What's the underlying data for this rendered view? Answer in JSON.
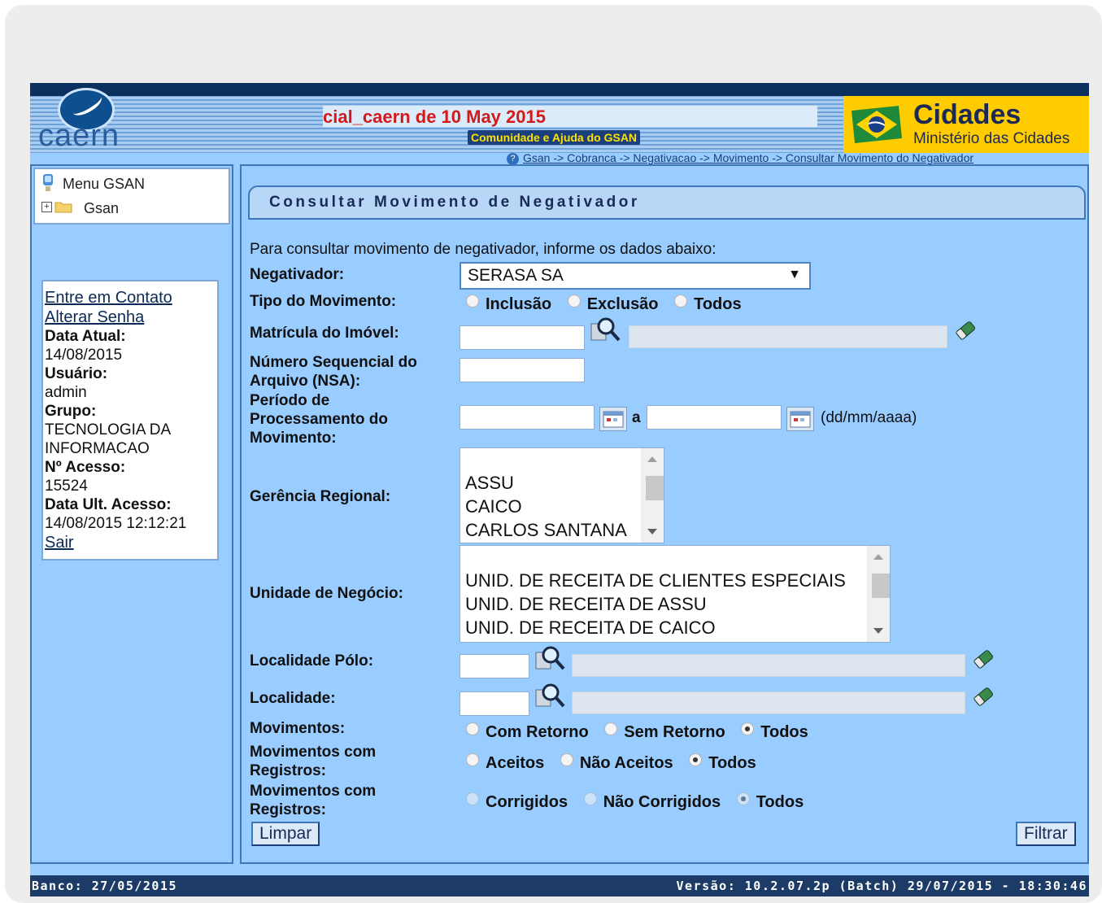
{
  "header": {
    "logo_text": "caern",
    "banner_text": "cial_caern de 10 May 2015",
    "community_link": "Comunidade e Ajuda do GSAN",
    "ministry_title": "Cidades",
    "ministry_subtitle": "Ministério das Cidades",
    "breadcrumb": "Gsan -> Cobranca -> Negativacao -> Movimento -> Consultar Movimento do Negativador"
  },
  "sidebar": {
    "menu_title": "Menu GSAN",
    "tree_root": "Gsan",
    "contact_link": "Entre em Contato",
    "change_password_link": "Alterar Senha",
    "current_date_label": "Data Atual:",
    "current_date": "14/08/2015",
    "user_label": "Usuário:",
    "user": "admin",
    "group_label": "Grupo:",
    "group_line1": "TECNOLOGIA DA",
    "group_line2": "INFORMACAO",
    "access_count_label": "Nº Acesso:",
    "access_count": "15524",
    "last_access_label": "Data Ult. Acesso:",
    "last_access": "14/08/2015 12:12:21",
    "logout_link": "Sair"
  },
  "form": {
    "title": "Consultar Movimento de Negativador",
    "instruction": "Para consultar movimento de negativador, informe os dados abaixo:",
    "negativador_label": "Negativador:",
    "negativador_value": "SERASA SA",
    "tipo_label": "Tipo do Movimento:",
    "tipo_options": [
      "Inclusão",
      "Exclusão",
      "Todos"
    ],
    "matricula_label": "Matrícula do Imóvel:",
    "nsa_label_1": "Número Sequencial do",
    "nsa_label_2": "Arquivo (NSA):",
    "periodo_label_1": "Período de",
    "periodo_label_2": "Processamento do",
    "periodo_label_3": "Movimento:",
    "periodo_sep": "a",
    "periodo_format": "(dd/mm/aaaa)",
    "gerencia_label": "Gerência Regional:",
    "gerencia_options": [
      "ASSU",
      "CAICO",
      "CARLOS SANTANA"
    ],
    "unidade_label": "Unidade de Negócio:",
    "unidade_options": [
      "UNID. DE RECEITA DE CLIENTES ESPECIAIS",
      "UNID. DE RECEITA DE ASSU",
      "UNID. DE RECEITA DE CAICO"
    ],
    "localidade_polo_label": "Localidade Pólo:",
    "localidade_label": "Localidade:",
    "movimentos_label": "Movimentos:",
    "movimentos_options": [
      "Com Retorno",
      "Sem Retorno",
      "Todos"
    ],
    "mov_registros_label_1": "Movimentos com",
    "mov_registros_label_2": "Registros:",
    "aceitos_options": [
      "Aceitos",
      "Não Aceitos",
      "Todos"
    ],
    "corrigidos_options": [
      "Corrigidos",
      "Não Corrigidos",
      "Todos"
    ],
    "clear_button": "Limpar",
    "filter_button": "Filtrar"
  },
  "footer": {
    "bank": "Banco: 27/05/2015",
    "version": "Versão: 10.2.07.2p (Batch) 29/07/2015 - 18:30:46"
  },
  "colors": {
    "page_background": "#99ccff",
    "footer": "#1c3b66",
    "ministry_yellow": "#ffcc00",
    "banner_red": "#d21a1a"
  }
}
